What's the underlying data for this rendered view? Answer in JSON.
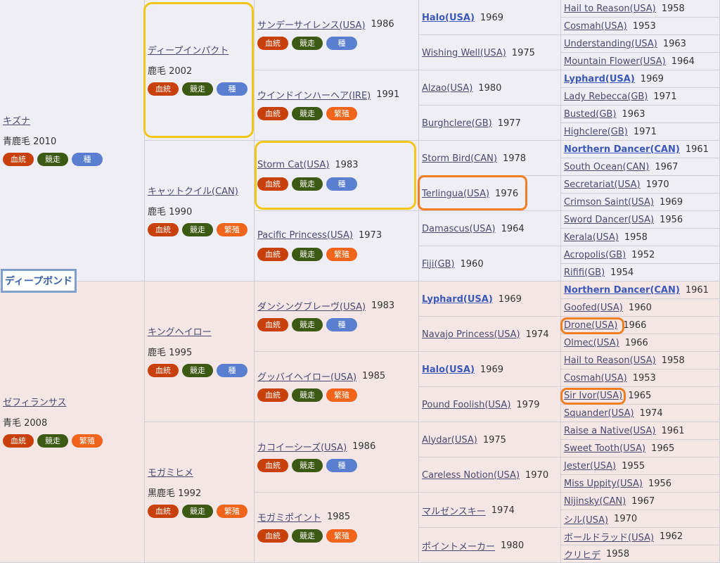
{
  "subject": "ディープボンド",
  "badges": {
    "blood": "血統",
    "race": "競走",
    "seed": "種",
    "breed": "繁殖"
  },
  "gen1": [
    {
      "name": "キズナ",
      "color": "青鹿毛 2010",
      "badges": [
        "blood",
        "race",
        "seed"
      ]
    },
    {
      "name": "ゼフィランサス",
      "color": "青毛 2008",
      "badges": [
        "blood",
        "race",
        "breed"
      ]
    }
  ],
  "gen2": [
    {
      "name": "ディープインパクト",
      "color": "鹿毛 2002",
      "badges": [
        "blood",
        "race",
        "seed"
      ]
    },
    {
      "name": "キャットクイル(CAN)",
      "color": "鹿毛 1990",
      "badges": [
        "blood",
        "race",
        "breed"
      ]
    },
    {
      "name": "キングヘイロー",
      "color": "鹿毛 1995",
      "badges": [
        "blood",
        "race",
        "seed"
      ]
    },
    {
      "name": "モガミヒメ",
      "color": "黒鹿毛 1992",
      "badges": [
        "blood",
        "race",
        "breed"
      ]
    }
  ],
  "gen3": [
    {
      "name": "サンデーサイレンス(USA)",
      "year": "1986",
      "badges": [
        "blood",
        "race",
        "seed"
      ]
    },
    {
      "name": "ウインドインハーヘア(IRE)",
      "year": "1991",
      "badges": [
        "blood",
        "race",
        "breed"
      ]
    },
    {
      "name": "Storm Cat(USA)",
      "year": "1983",
      "badges": [
        "blood",
        "race",
        "seed"
      ]
    },
    {
      "name": "Pacific Princess(USA)",
      "year": "1973",
      "badges": [
        "blood",
        "race",
        "breed"
      ]
    },
    {
      "name": "ダンシングブレーヴ(USA)",
      "year": "1983",
      "badges": [
        "blood",
        "race",
        "seed"
      ]
    },
    {
      "name": "グッバイヘイロー(USA)",
      "year": "1985",
      "badges": [
        "blood",
        "race",
        "breed"
      ]
    },
    {
      "name": "カコイーシーズ(USA)",
      "year": "1986",
      "badges": [
        "blood",
        "race",
        "seed"
      ]
    },
    {
      "name": "モガミポイント",
      "year": "1985",
      "badges": [
        "blood",
        "race",
        "breed"
      ]
    }
  ],
  "gen4": [
    {
      "name": "Halo(USA)",
      "year": "1969",
      "bold": true
    },
    {
      "name": "Wishing Well(USA)",
      "year": "1975"
    },
    {
      "name": "Alzao(USA)",
      "year": "1980"
    },
    {
      "name": "Burghclere(GB)",
      "year": "1977"
    },
    {
      "name": "Storm Bird(CAN)",
      "year": "1978"
    },
    {
      "name": "Terlingua(USA)",
      "year": "1976"
    },
    {
      "name": "Damascus(USA)",
      "year": "1964"
    },
    {
      "name": "Fiji(GB)",
      "year": "1960"
    },
    {
      "name": "Lyphard(USA)",
      "year": "1969",
      "bold": true
    },
    {
      "name": "Navajo Princess(USA)",
      "year": "1974"
    },
    {
      "name": "Halo(USA)",
      "year": "1969",
      "bold": true
    },
    {
      "name": "Pound Foolish(USA)",
      "year": "1979"
    },
    {
      "name": "Alydar(USA)",
      "year": "1975"
    },
    {
      "name": "Careless Notion(USA)",
      "year": "1970"
    },
    {
      "name": "マルゼンスキー",
      "year": "1974"
    },
    {
      "name": "ポイントメーカー",
      "year": "1980"
    }
  ],
  "gen5": [
    {
      "name": "Hail to Reason(USA)",
      "year": "1958"
    },
    {
      "name": "Cosmah(USA)",
      "year": "1953"
    },
    {
      "name": "Understanding(USA)",
      "year": "1963"
    },
    {
      "name": "Mountain Flower(USA)",
      "year": "1964"
    },
    {
      "name": "Lyphard(USA)",
      "year": "1969",
      "bold": true
    },
    {
      "name": "Lady Rebecca(GB)",
      "year": "1971"
    },
    {
      "name": "Busted(GB)",
      "year": "1963"
    },
    {
      "name": "Highclere(GB)",
      "year": "1971"
    },
    {
      "name": "Northern Dancer(CAN)",
      "year": "1961",
      "bold": true
    },
    {
      "name": "South Ocean(CAN)",
      "year": "1967"
    },
    {
      "name": "Secretariat(USA)",
      "year": "1970"
    },
    {
      "name": "Crimson Saint(USA)",
      "year": "1969"
    },
    {
      "name": "Sword Dancer(USA)",
      "year": "1956"
    },
    {
      "name": "Kerala(USA)",
      "year": "1958"
    },
    {
      "name": "Acropolis(GB)",
      "year": "1952"
    },
    {
      "name": "Rififi(GB)",
      "year": "1954"
    },
    {
      "name": "Northern Dancer(CAN)",
      "year": "1961",
      "bold": true
    },
    {
      "name": "Goofed(USA)",
      "year": "1960"
    },
    {
      "name": "Drone(USA)",
      "year": "1966"
    },
    {
      "name": "Olmec(USA)",
      "year": "1966"
    },
    {
      "name": "Hail to Reason(USA)",
      "year": "1958"
    },
    {
      "name": "Cosmah(USA)",
      "year": "1953"
    },
    {
      "name": "Sir Ivor(USA)",
      "year": "1965"
    },
    {
      "name": "Squander(USA)",
      "year": "1974"
    },
    {
      "name": "Raise a Native(USA)",
      "year": "1961"
    },
    {
      "name": "Sweet Tooth(USA)",
      "year": "1965"
    },
    {
      "name": "Jester(USA)",
      "year": "1955"
    },
    {
      "name": "Miss Uppity(USA)",
      "year": "1956"
    },
    {
      "name": "Nijinsky(CAN)",
      "year": "1967"
    },
    {
      "name": "シル(USA)",
      "year": "1970"
    },
    {
      "name": "ボールドラッド(USA)",
      "year": "1962"
    },
    {
      "name": "クリヒデ",
      "year": "1958"
    }
  ],
  "highlights": {
    "yellow": [
      {
        "gen": "gen2",
        "index": 0
      },
      {
        "gen": "gen3",
        "index": 2
      }
    ],
    "orange": [
      {
        "gen": "gen4",
        "index": 5
      },
      {
        "gen": "gen5",
        "index": 18
      },
      {
        "gen": "gen5",
        "index": 22
      }
    ]
  }
}
